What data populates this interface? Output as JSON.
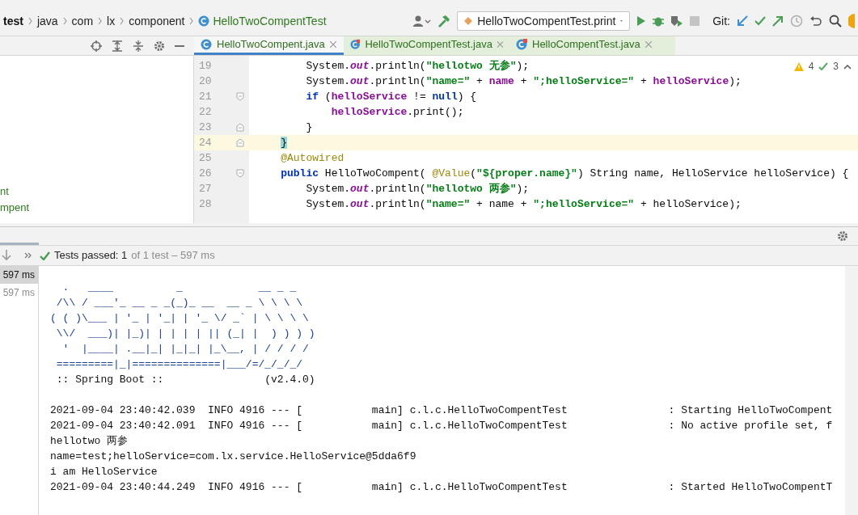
{
  "breadcrumbs": [
    {
      "label": "test",
      "kind": "module"
    },
    {
      "label": "java",
      "kind": "folder"
    },
    {
      "label": "com",
      "kind": "folder"
    },
    {
      "label": "lx",
      "kind": "folder"
    },
    {
      "label": "component",
      "kind": "folder"
    },
    {
      "label": "HelloTwoCompentTest",
      "kind": "class"
    }
  ],
  "run_config": {
    "label": "HelloTwoCompentTest.print"
  },
  "git_label": "Git:",
  "editor_tabs": [
    {
      "label": "HelloTwoCompent.java",
      "selected": true,
      "kind": "class"
    },
    {
      "label": "HelloTwoCompentTest.java",
      "selected": false,
      "kind": "test"
    },
    {
      "label": "HelloCompentTest.java",
      "selected": false,
      "kind": "test"
    }
  ],
  "editor": {
    "warnings": "4",
    "weak_warnings": "3",
    "lines": [
      {
        "number": "19",
        "current": false,
        "tokens": [
          {
            "kind": "plain",
            "text": "        System."
          },
          {
            "kind": "static",
            "text": "out"
          },
          {
            "kind": "plain",
            "text": ".println("
          },
          {
            "kind": "string",
            "text": "\"hellotwo 无参\""
          },
          {
            "kind": "plain",
            "text": ");"
          }
        ]
      },
      {
        "number": "20",
        "current": false,
        "tokens": [
          {
            "kind": "plain",
            "text": "        System."
          },
          {
            "kind": "static",
            "text": "out"
          },
          {
            "kind": "plain",
            "text": ".println("
          },
          {
            "kind": "string",
            "text": "\"name=\""
          },
          {
            "kind": "plain",
            "text": " + "
          },
          {
            "kind": "field",
            "text": "name"
          },
          {
            "kind": "plain",
            "text": " + "
          },
          {
            "kind": "string",
            "text": "\";helloService=\""
          },
          {
            "kind": "plain",
            "text": " + "
          },
          {
            "kind": "field",
            "text": "helloService"
          },
          {
            "kind": "plain",
            "text": ");"
          }
        ]
      },
      {
        "number": "21",
        "current": false,
        "fold_start": true,
        "tokens": [
          {
            "kind": "keyword",
            "text": "        if"
          },
          {
            "kind": "plain",
            "text": " ("
          },
          {
            "kind": "field",
            "text": "helloService"
          },
          {
            "kind": "plain",
            "text": " != "
          },
          {
            "kind": "keyword",
            "text": "null"
          },
          {
            "kind": "plain",
            "text": ") {"
          }
        ]
      },
      {
        "number": "22",
        "current": false,
        "tokens": [
          {
            "kind": "field",
            "text": "            helloService"
          },
          {
            "kind": "plain",
            "text": ".print();"
          }
        ]
      },
      {
        "number": "23",
        "current": false,
        "fold_end": true,
        "tokens": [
          {
            "kind": "plain",
            "text": "        }"
          }
        ]
      },
      {
        "number": "24",
        "current": true,
        "fold_end": true,
        "tokens": [
          {
            "kind": "matched",
            "text": "    }"
          }
        ]
      },
      {
        "number": "25",
        "current": false,
        "tokens": [
          {
            "kind": "annotation",
            "text": "    @Autowired"
          }
        ]
      },
      {
        "number": "26",
        "current": false,
        "fold_start": true,
        "tokens": [
          {
            "kind": "keyword",
            "text": "    public"
          },
          {
            "kind": "plain",
            "text": " HelloTwoCompent( "
          },
          {
            "kind": "annotation",
            "text": "@Value"
          },
          {
            "kind": "plain",
            "text": "("
          },
          {
            "kind": "string",
            "text": "\"${proper.name}\""
          },
          {
            "kind": "plain",
            "text": ") String name, HelloService helloService) {"
          }
        ]
      },
      {
        "number": "27",
        "current": false,
        "tokens": [
          {
            "kind": "plain",
            "text": "        System."
          },
          {
            "kind": "static",
            "text": "out"
          },
          {
            "kind": "plain",
            "text": ".println("
          },
          {
            "kind": "string",
            "text": "\"hellotwo 两参\""
          },
          {
            "kind": "plain",
            "text": ");"
          }
        ]
      },
      {
        "number": "28",
        "current": false,
        "tokens": [
          {
            "kind": "plain",
            "text": "        System."
          },
          {
            "kind": "static",
            "text": "out"
          },
          {
            "kind": "plain",
            "text": ".println("
          },
          {
            "kind": "string",
            "text": "\"name=\""
          },
          {
            "kind": "plain",
            "text": " + name + "
          },
          {
            "kind": "string",
            "text": "\";helloService=\""
          },
          {
            "kind": "plain",
            "text": " + helloService);"
          }
        ]
      }
    ]
  },
  "project_tree": [
    {
      "label": "nt"
    },
    {
      "label": "mpent"
    }
  ],
  "test_results": {
    "status": "Tests passed: 1",
    "detail": "of 1 test – 597 ms",
    "tree": [
      {
        "label": "597 ms",
        "selected": true
      },
      {
        "label": "597 ms",
        "selected": false
      }
    ]
  },
  "console": {
    "banner": [
      "  .   ____          _            __ _ _",
      " /\\\\ / ___'_ __ _ _(_)_ __  __ _ \\ \\ \\ \\",
      "( ( )\\___ | '_ | '_| | '_ \\/ _` | \\ \\ \\ \\",
      " \\\\/  ___)| |_)| | | | | || (_| |  ) ) ) )",
      "  '  |____| .__|_| |_|_| |_\\__, | / / / /",
      " =========|_|==============|___/=/_/_/_/"
    ],
    "version_line": " :: Spring Boot ::                (v2.4.0)",
    "lines": [
      "2021-09-04 23:40:42.039  INFO 4916 --- [           main] c.l.c.HelloTwoCompentTest                : Starting HelloTwoCompent",
      "2021-09-04 23:40:42.091  INFO 4916 --- [           main] c.l.c.HelloTwoCompentTest                : No active profile set, f",
      "hellotwo 两参",
      "name=test;helloService=com.lx.service.HelloService@5dda6f9",
      "i am HelloService",
      "2021-09-04 23:40:44.249  INFO 4916 --- [           main] c.l.c.HelloTwoCompentTest                : Started HelloTwoCompentT"
    ]
  }
}
